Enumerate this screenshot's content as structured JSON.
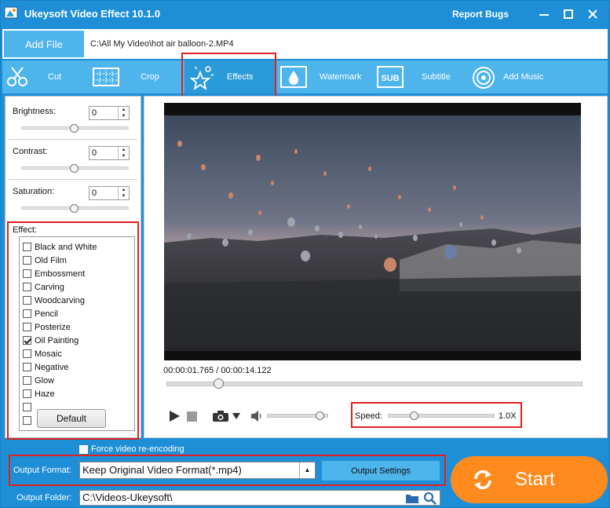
{
  "window": {
    "title": "Ukeysoft Video Effect 10.1.0",
    "report_bugs": "Report Bugs"
  },
  "file": {
    "add_label": "Add File",
    "path": "C:\\All My Video\\hot air balloon-2.MP4"
  },
  "tabs": [
    {
      "label": "Cut",
      "icon": "cut-icon"
    },
    {
      "label": "Crop",
      "icon": "crop-icon"
    },
    {
      "label": "Effects",
      "icon": "effects-icon",
      "active": true
    },
    {
      "label": "Watermark",
      "icon": "watermark-icon"
    },
    {
      "label": "Subtitle",
      "icon": "subtitle-icon"
    },
    {
      "label": "Add Music",
      "icon": "music-icon"
    }
  ],
  "adjust": {
    "brightness_label": "Brightness:",
    "brightness_value": "0",
    "contrast_label": "Contrast:",
    "contrast_value": "0",
    "saturation_label": "Saturation:",
    "saturation_value": "0"
  },
  "effects": {
    "title": "Effect:",
    "items": [
      {
        "label": "Black and White",
        "checked": false
      },
      {
        "label": "Old Film",
        "checked": false
      },
      {
        "label": "Embossment",
        "checked": false
      },
      {
        "label": "Carving",
        "checked": false
      },
      {
        "label": "Woodcarving",
        "checked": false
      },
      {
        "label": "Pencil",
        "checked": false
      },
      {
        "label": "Posterize",
        "checked": false
      },
      {
        "label": "Oil Painting",
        "checked": true
      },
      {
        "label": "Mosaic",
        "checked": false
      },
      {
        "label": "Negative",
        "checked": false
      },
      {
        "label": "Glow",
        "checked": false
      },
      {
        "label": "Haze",
        "checked": false
      }
    ],
    "default_button": "Default"
  },
  "player": {
    "time": "00:00:01.765 / 00:00:14.122",
    "seek_fraction": 0.125,
    "volume_fraction": 0.85,
    "speed_label": "Speed:",
    "speed_value": "1.0X"
  },
  "output": {
    "force_label": "Force video re-encoding",
    "format_label": "Output Format:",
    "format_value": "Keep Original Video Format(*.mp4)",
    "settings_button": "Output Settings",
    "folder_label": "Output Folder:",
    "folder_value": "C:\\Videos-Ukeysoft\\",
    "start_label": "Start"
  },
  "colors": {
    "title_blue": "#1e8fd6",
    "tab_blue": "#4eb4ec",
    "start_orange": "#ff8a1e",
    "highlight_red": "#e02020"
  }
}
